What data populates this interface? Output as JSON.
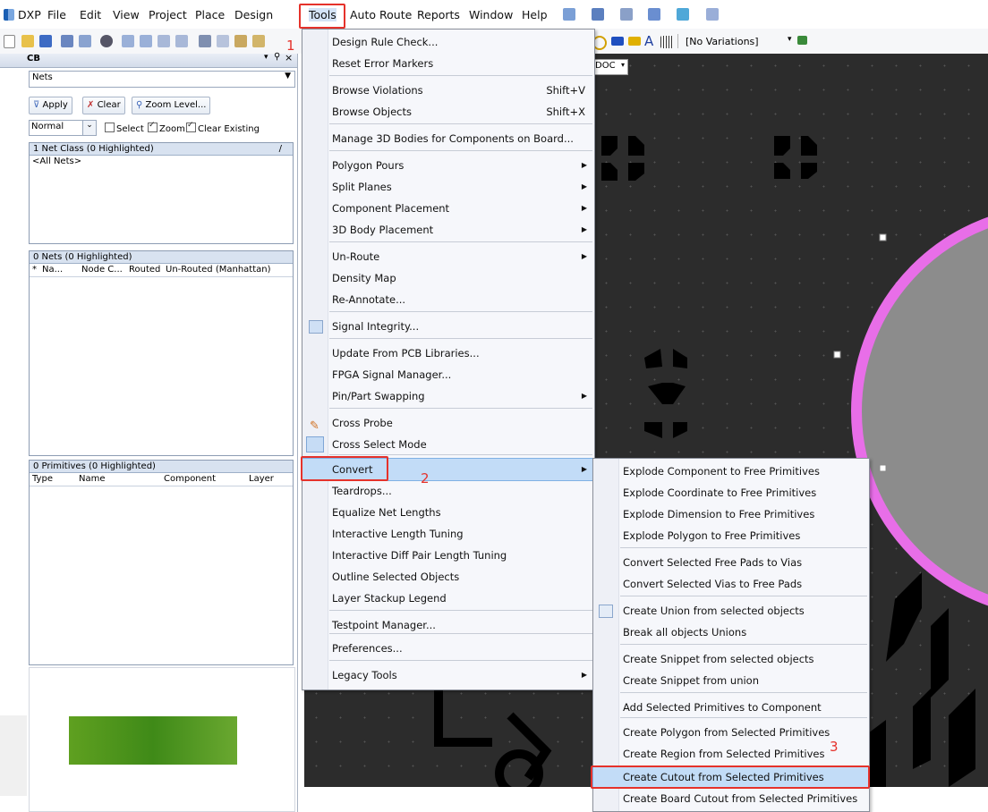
{
  "menubar": {
    "items": [
      "DXP",
      "File",
      "Edit",
      "View",
      "Project",
      "Place",
      "Design",
      "Tools",
      "Auto Route",
      "Reports",
      "Window",
      "Help"
    ],
    "underline_index": [
      0,
      0,
      0,
      0,
      5,
      0,
      0,
      0,
      0,
      0,
      0,
      0
    ]
  },
  "toolbar2": {
    "variations": "[No Variations]",
    "doc_combo": "DOC"
  },
  "panel": {
    "title": "CB",
    "nets_combo": "Nets",
    "apply_label": "Apply",
    "clear_label": "Clear",
    "zoom_label": "Zoom Level...",
    "mode_combo": "Normal",
    "select_label": "Select",
    "zoom_check_label": "Zoom",
    "clear_existing_label": "Clear Existing",
    "net_class_header": "1 Net Class (0 Highlighted)",
    "net_class_item": "<All Nets>",
    "nets_header": "0 Nets (0 Highlighted)",
    "nets_columns": [
      "*",
      "Na...",
      "Node C...",
      "Routed",
      "Un-Routed (Manhattan)"
    ],
    "primitives_header": "0 Primitives (0 Highlighted)",
    "primitives_columns": [
      "Type",
      "Name",
      "Component",
      "Layer"
    ]
  },
  "tools_menu": {
    "items": [
      {
        "label": "Design Rule Check...",
        "shortcut": ""
      },
      {
        "label": "Reset Error Markers",
        "shortcut": ""
      },
      {
        "label": "Browse Violations",
        "shortcut": "Shift+V"
      },
      {
        "label": "Browse Objects",
        "shortcut": "Shift+X"
      },
      {
        "label": "Manage 3D Bodies for Components on Board...",
        "shortcut": ""
      },
      {
        "label": "Polygon Pours",
        "shortcut": "",
        "submenu": true
      },
      {
        "label": "Split Planes",
        "shortcut": "",
        "submenu": true
      },
      {
        "label": "Component Placement",
        "shortcut": "",
        "submenu": true
      },
      {
        "label": "3D Body Placement",
        "shortcut": "",
        "submenu": true
      },
      {
        "label": "Un-Route",
        "shortcut": "",
        "submenu": true
      },
      {
        "label": "Density Map",
        "shortcut": ""
      },
      {
        "label": "Re-Annotate...",
        "shortcut": ""
      },
      {
        "label": "Signal Integrity...",
        "shortcut": ""
      },
      {
        "label": "Update From PCB Libraries...",
        "shortcut": ""
      },
      {
        "label": "FPGA Signal Manager...",
        "shortcut": ""
      },
      {
        "label": "Pin/Part Swapping",
        "shortcut": "",
        "submenu": true
      },
      {
        "label": "Cross Probe",
        "shortcut": ""
      },
      {
        "label": "Cross Select Mode",
        "shortcut": ""
      },
      {
        "label": "Convert",
        "shortcut": "",
        "submenu": true
      },
      {
        "label": "Teardrops...",
        "shortcut": ""
      },
      {
        "label": "Equalize Net Lengths",
        "shortcut": ""
      },
      {
        "label": "Interactive Length Tuning",
        "shortcut": ""
      },
      {
        "label": "Interactive Diff Pair Length Tuning",
        "shortcut": ""
      },
      {
        "label": "Outline Selected Objects",
        "shortcut": ""
      },
      {
        "label": "Layer Stackup Legend",
        "shortcut": ""
      },
      {
        "label": "Testpoint Manager...",
        "shortcut": ""
      },
      {
        "label": "Preferences...",
        "shortcut": ""
      },
      {
        "label": "Legacy Tools",
        "shortcut": "",
        "submenu": true
      }
    ]
  },
  "convert_menu": {
    "items": [
      "Explode Component to Free Primitives",
      "Explode Coordinate to Free Primitives",
      "Explode Dimension to Free Primitives",
      "Explode Polygon to Free Primitives",
      "Convert Selected Free Pads to Vias",
      "Convert Selected Vias to Free Pads",
      "Create Union from selected objects",
      "Break all objects Unions",
      "Create Snippet from selected objects",
      "Create Snippet from union",
      "Add Selected Primitives to Component",
      "Create Polygon from Selected Primitives",
      "Create Region from Selected Primitives",
      "Create Cutout from Selected Primitives",
      "Create Board Cutout from Selected Primitives"
    ]
  },
  "annotations": {
    "step1": "1",
    "step2": "2",
    "step3": "3"
  },
  "colors": {
    "annotation": "#e5322b",
    "highlight": "#c2dcf7",
    "canvas": "#2c2c2c",
    "pink": "#e86ee8"
  }
}
